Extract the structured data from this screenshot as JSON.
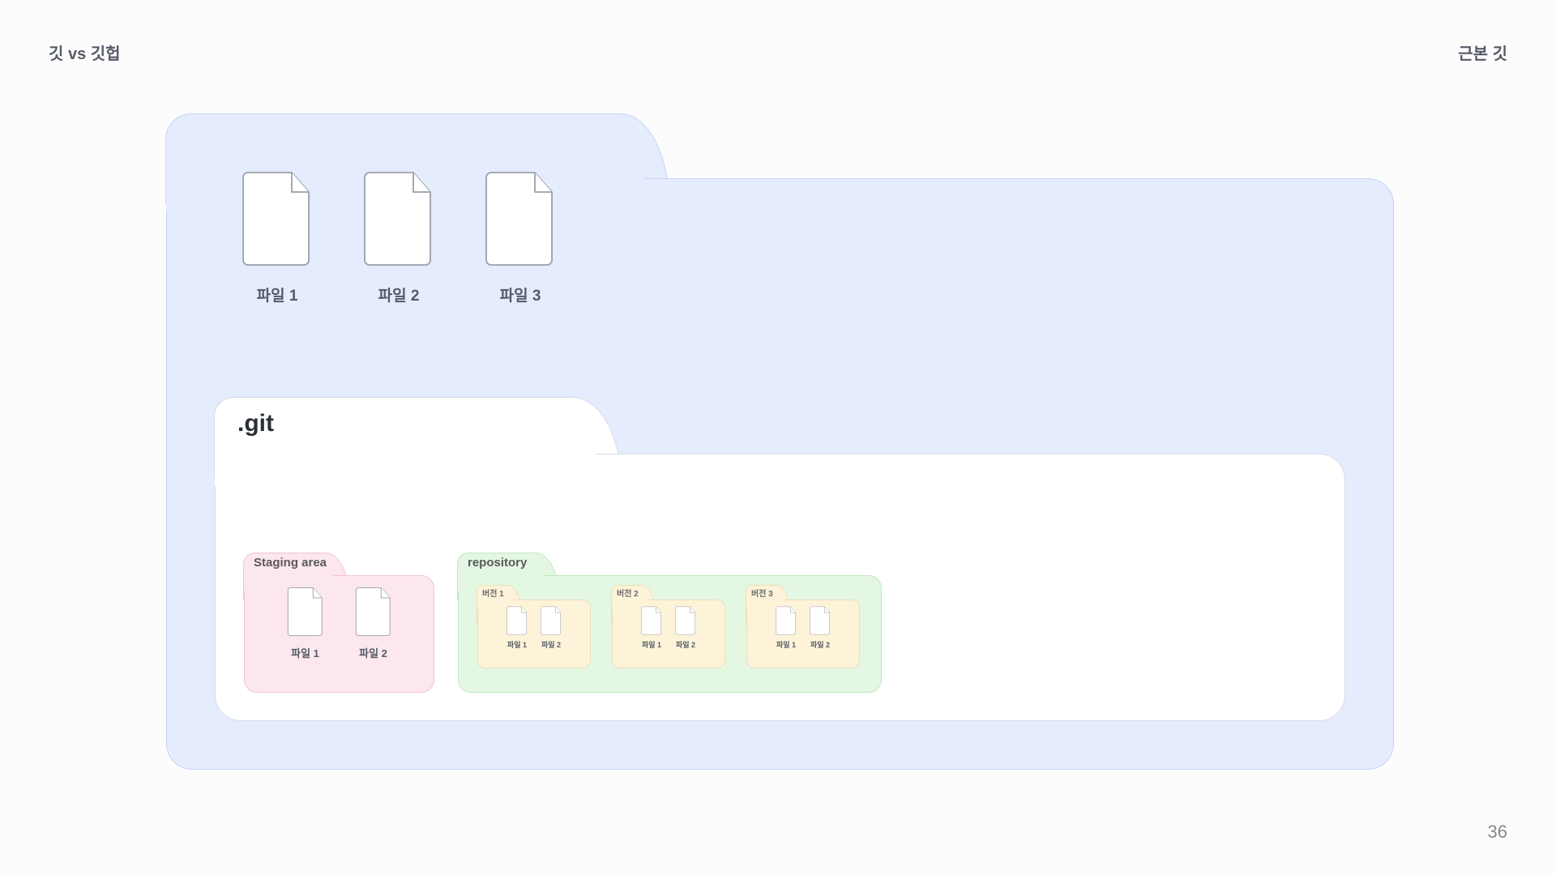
{
  "header": {
    "left": "깃 vs 깃헙",
    "right": "근본 깃"
  },
  "page_number": "36",
  "working_directory": {
    "files": [
      {
        "label": "파일 1"
      },
      {
        "label": "파일 2"
      },
      {
        "label": "파일 3"
      }
    ]
  },
  "git_folder": {
    "label": ".git",
    "staging_area": {
      "label": "Staging area",
      "files": [
        {
          "label": "파일 1"
        },
        {
          "label": "파일 2"
        }
      ]
    },
    "repository": {
      "label": "repository",
      "versions": [
        {
          "label": "버전 1",
          "files": [
            {
              "label": "파일 1"
            },
            {
              "label": "파일 2"
            }
          ]
        },
        {
          "label": "버전 2",
          "files": [
            {
              "label": "파일 1"
            },
            {
              "label": "파일 2"
            }
          ]
        },
        {
          "label": "버전 3",
          "files": [
            {
              "label": "파일 1"
            },
            {
              "label": "파일 2"
            }
          ]
        }
      ]
    }
  }
}
